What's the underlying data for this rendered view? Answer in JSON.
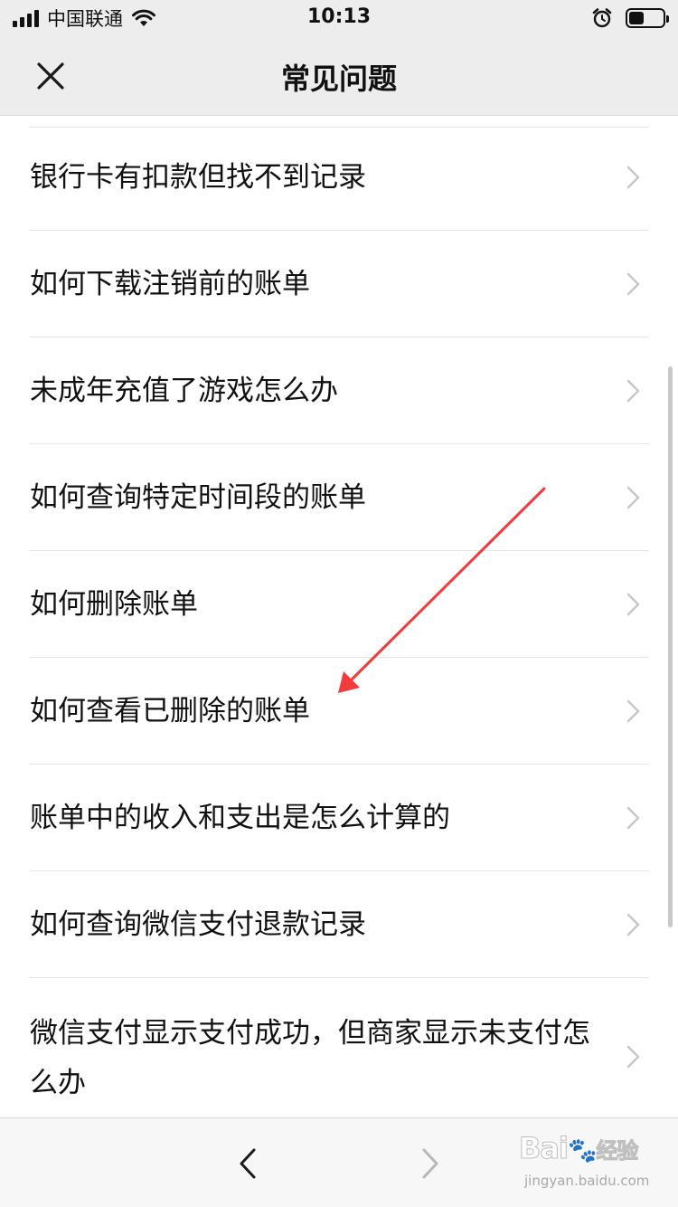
{
  "status_bar": {
    "carrier": "中国联通",
    "time": "10:13",
    "battery_level": 0.45
  },
  "header": {
    "title": "常见问题"
  },
  "faq": {
    "items": [
      {
        "label": "银行卡有扣款但找不到记录"
      },
      {
        "label": "如何下载注销前的账单"
      },
      {
        "label": "未成年充值了游戏怎么办"
      },
      {
        "label": "如何查询特定时间段的账单"
      },
      {
        "label": "如何删除账单"
      },
      {
        "label": "如何查看已删除的账单"
      },
      {
        "label": "账单中的收入和支出是怎么计算的"
      },
      {
        "label": "如何查询微信支付退款记录"
      },
      {
        "label": "微信支付显示支付成功，但商家显示未支付怎么办"
      }
    ]
  },
  "watermark": {
    "brand": "Bai",
    "brand_cn": "经验",
    "url": "jingyan.baidu.com"
  },
  "colors": {
    "annotation_arrow": "#f03c3c",
    "header_bg": "#ededed",
    "divider": "#e5e5e5",
    "chevron": "#c7c7cc"
  }
}
